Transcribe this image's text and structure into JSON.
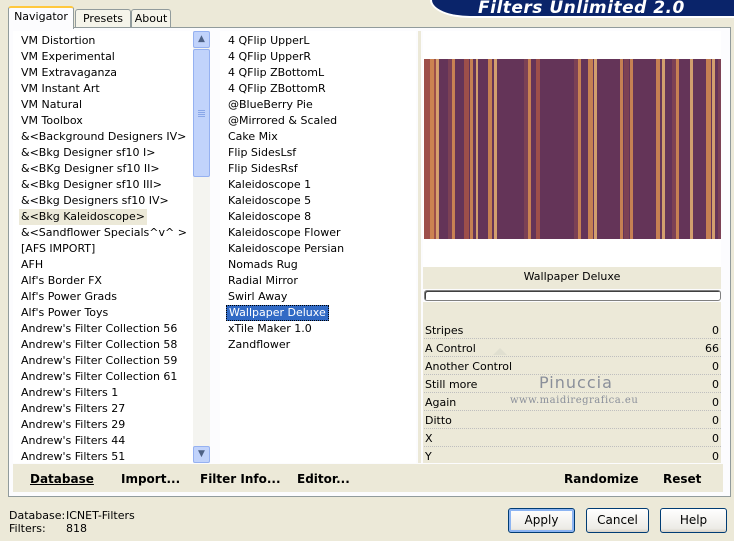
{
  "tabs": [
    {
      "label": "Navigator"
    },
    {
      "label": "Presets"
    },
    {
      "label": "About"
    }
  ],
  "title": "Filters Unlimited 2.0",
  "categories": [
    {
      "label": "VM Distortion"
    },
    {
      "label": "VM Experimental"
    },
    {
      "label": "VM Extravaganza"
    },
    {
      "label": "VM Instant Art"
    },
    {
      "label": "VM Natural"
    },
    {
      "label": "VM Toolbox"
    },
    {
      "label": "&<Background Designers IV>"
    },
    {
      "label": "&<Bkg Designer sf10 I>"
    },
    {
      "label": "&<BKg Designer sf10 II>"
    },
    {
      "label": "&<Bkg Designer sf10 III>"
    },
    {
      "label": "&<Bkg Designers sf10 IV>"
    },
    {
      "label": "&<Bkg Kaleidoscope>"
    },
    {
      "label": "&<Sandflower Specials^v^ >"
    },
    {
      "label": "[AFS IMPORT]"
    },
    {
      "label": "AFH"
    },
    {
      "label": "Alf's Border FX"
    },
    {
      "label": "Alf's Power Grads"
    },
    {
      "label": "Alf's Power Toys"
    },
    {
      "label": "Andrew's Filter Collection 56"
    },
    {
      "label": "Andrew's Filter Collection 58"
    },
    {
      "label": "Andrew's Filter Collection 59"
    },
    {
      "label": "Andrew's Filter Collection 61"
    },
    {
      "label": "Andrew's Filters 1"
    },
    {
      "label": "Andrew's Filters 27"
    },
    {
      "label": "Andrew's Filters 29"
    },
    {
      "label": "Andrew's Filters 44"
    },
    {
      "label": "Andrew's Filters 51"
    }
  ],
  "filters": [
    {
      "label": "4 QFlip UpperL"
    },
    {
      "label": "4 QFlip UpperR"
    },
    {
      "label": "4 QFlip ZBottomL"
    },
    {
      "label": "4 QFlip ZBottomR"
    },
    {
      "label": "@BlueBerry Pie"
    },
    {
      "label": "@Mirrored & Scaled"
    },
    {
      "label": "Cake Mix"
    },
    {
      "label": "Flip SidesLsf"
    },
    {
      "label": "Flip SidesRsf"
    },
    {
      "label": "Kaleidoscope 1"
    },
    {
      "label": "Kaleidoscope 5"
    },
    {
      "label": "Kaleidoscope 8"
    },
    {
      "label": "Kaleidoscope Flower"
    },
    {
      "label": "Kaleidoscope Persian"
    },
    {
      "label": "Nomads Rug"
    },
    {
      "label": "Radial Mirror"
    },
    {
      "label": "Swirl Away"
    },
    {
      "label": "Wallpaper Deluxe"
    },
    {
      "label": "xTile Maker 1.0"
    },
    {
      "label": "Zandflower"
    }
  ],
  "selected_category_index": 11,
  "selected_filter_index": 17,
  "selected_filter_name": "Wallpaper Deluxe",
  "controls": [
    {
      "label": "Stripes",
      "value": "0"
    },
    {
      "label": "A Control",
      "value": "66"
    },
    {
      "label": "Another Control",
      "value": "0"
    },
    {
      "label": "Still more",
      "value": "0"
    },
    {
      "label": "Again",
      "value": "0"
    },
    {
      "label": "Ditto",
      "value": "0"
    },
    {
      "label": "X",
      "value": "0"
    },
    {
      "label": "Y",
      "value": "0"
    }
  ],
  "watermark": {
    "name": "Pinuccia",
    "url": "www.maidiregrafica.eu"
  },
  "bottom_actions": {
    "database": "Database",
    "import": "Import...",
    "filter_info": "Filter Info...",
    "editor": "Editor...",
    "randomize": "Randomize",
    "reset": "Reset"
  },
  "info": {
    "database_label": "Database:",
    "database_value": "ICNET-Filters",
    "filters_label": "Filters:",
    "filters_value": "818"
  },
  "buttons": {
    "apply": "Apply",
    "cancel": "Cancel",
    "help": "Help"
  },
  "colors": {
    "preview_stripes": [
      "#6a3a5e",
      "#b25c4c",
      "#e79a58",
      "#f5c07a",
      "#8a4a5a"
    ],
    "selection": "#316ac5"
  }
}
